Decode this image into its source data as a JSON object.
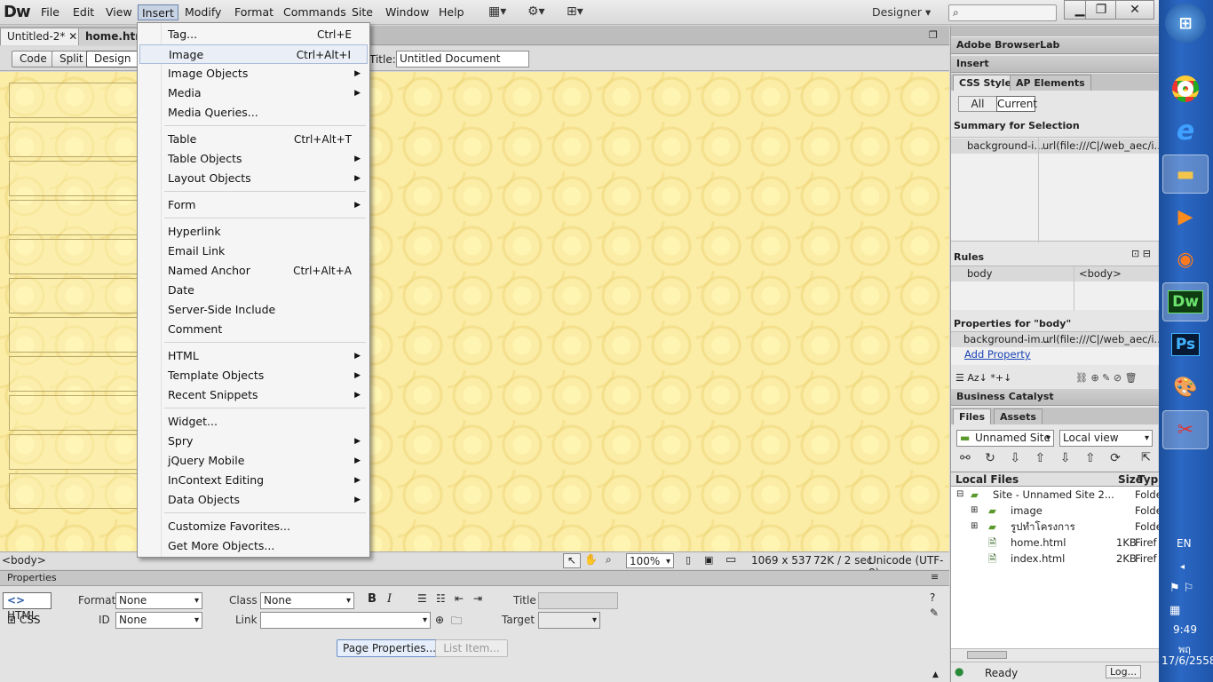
{
  "app": {
    "logo": "Dw",
    "workspace": "Designer"
  },
  "menubar": [
    "File",
    "Edit",
    "View",
    "Insert",
    "Modify",
    "Format",
    "Commands",
    "Site",
    "Window",
    "Help"
  ],
  "tabs": [
    "Untitled-2*",
    "home.html"
  ],
  "doc_toolbar": {
    "code": "Code",
    "split": "Split",
    "design": "Design",
    "title_label": "Title:",
    "title_value": "Untitled Document"
  },
  "insert_menu": [
    {
      "label": "Tag...",
      "shortcut": "Ctrl+E"
    },
    {
      "label": "Image",
      "shortcut": "Ctrl+Alt+I",
      "highlight": true
    },
    {
      "label": "Image Objects",
      "sub": true
    },
    {
      "label": "Media",
      "sub": true
    },
    {
      "label": "Media Queries..."
    },
    {
      "sep": true
    },
    {
      "label": "Table",
      "shortcut": "Ctrl+Alt+T"
    },
    {
      "label": "Table Objects",
      "sub": true
    },
    {
      "label": "Layout Objects",
      "sub": true
    },
    {
      "sep": true
    },
    {
      "label": "Form",
      "sub": true
    },
    {
      "sep": true
    },
    {
      "label": "Hyperlink"
    },
    {
      "label": "Email Link"
    },
    {
      "label": "Named Anchor",
      "shortcut": "Ctrl+Alt+A"
    },
    {
      "label": "Date"
    },
    {
      "label": "Server-Side Include"
    },
    {
      "label": "Comment"
    },
    {
      "sep": true
    },
    {
      "label": "HTML",
      "sub": true
    },
    {
      "label": "Template Objects",
      "sub": true
    },
    {
      "label": "Recent Snippets",
      "sub": true
    },
    {
      "sep": true
    },
    {
      "label": "Widget..."
    },
    {
      "label": "Spry",
      "sub": true
    },
    {
      "label": "jQuery Mobile",
      "sub": true
    },
    {
      "label": "InContext Editing",
      "sub": true
    },
    {
      "label": "Data Objects",
      "sub": true
    },
    {
      "sep": true
    },
    {
      "label": "Customize Favorites..."
    },
    {
      "label": "Get More Objects..."
    }
  ],
  "status": {
    "tag": "<body>",
    "zoom": "100%",
    "size": "1069 x 537",
    "dl": "72K / 2 sec",
    "enc": "Unicode (UTF-8)"
  },
  "properties": {
    "header": "Properties",
    "html": "HTML",
    "css": "CSS",
    "format_label": "Format",
    "format_value": "None",
    "class_label": "Class",
    "class_value": "None",
    "id_label": "ID",
    "id_value": "None",
    "link_label": "Link",
    "title_label": "Title",
    "target_label": "Target",
    "page_props": "Page Properties...",
    "list_item": "List Item..."
  },
  "panels": {
    "browserlab": "Adobe BrowserLab",
    "insert": "Insert",
    "css_tab": "CSS Styles",
    "ap_tab": "AP Elements",
    "all": "All",
    "current": "Current",
    "summary": "Summary for Selection",
    "summary_prop": "background-i...",
    "summary_val": "url(file:///C|/web_aec/i...",
    "rules": "Rules",
    "rule_sel": "body",
    "rule_tag": "<body>",
    "props_for": "Properties for \"body\"",
    "prop_name": "background-im...",
    "prop_val": "url(file:///C|/web_aec/i...",
    "add_prop": "Add Property",
    "bc": "Business Catalyst",
    "files_tab": "Files",
    "assets_tab": "Assets",
    "site_sel": "Unnamed Site",
    "view_sel": "Local view",
    "col_local": "Local Files",
    "col_size": "Size",
    "col_type": "Typ",
    "files": [
      {
        "name": "Site - Unnamed Site 2...",
        "size": "",
        "type": "Folde"
      },
      {
        "name": "image",
        "size": "",
        "type": "Folde"
      },
      {
        "name": "รูปทำโครงการ",
        "size": "",
        "type": "Folde"
      },
      {
        "name": "home.html",
        "size": "1KB",
        "type": "Firef"
      },
      {
        "name": "index.html",
        "size": "2KB",
        "type": "Firef"
      }
    ],
    "ready": "Ready",
    "log": "Log..."
  },
  "taskbar": {
    "lang": "EN",
    "time": "9:49",
    "day": "พฤ",
    "date": "17/6/2558"
  }
}
